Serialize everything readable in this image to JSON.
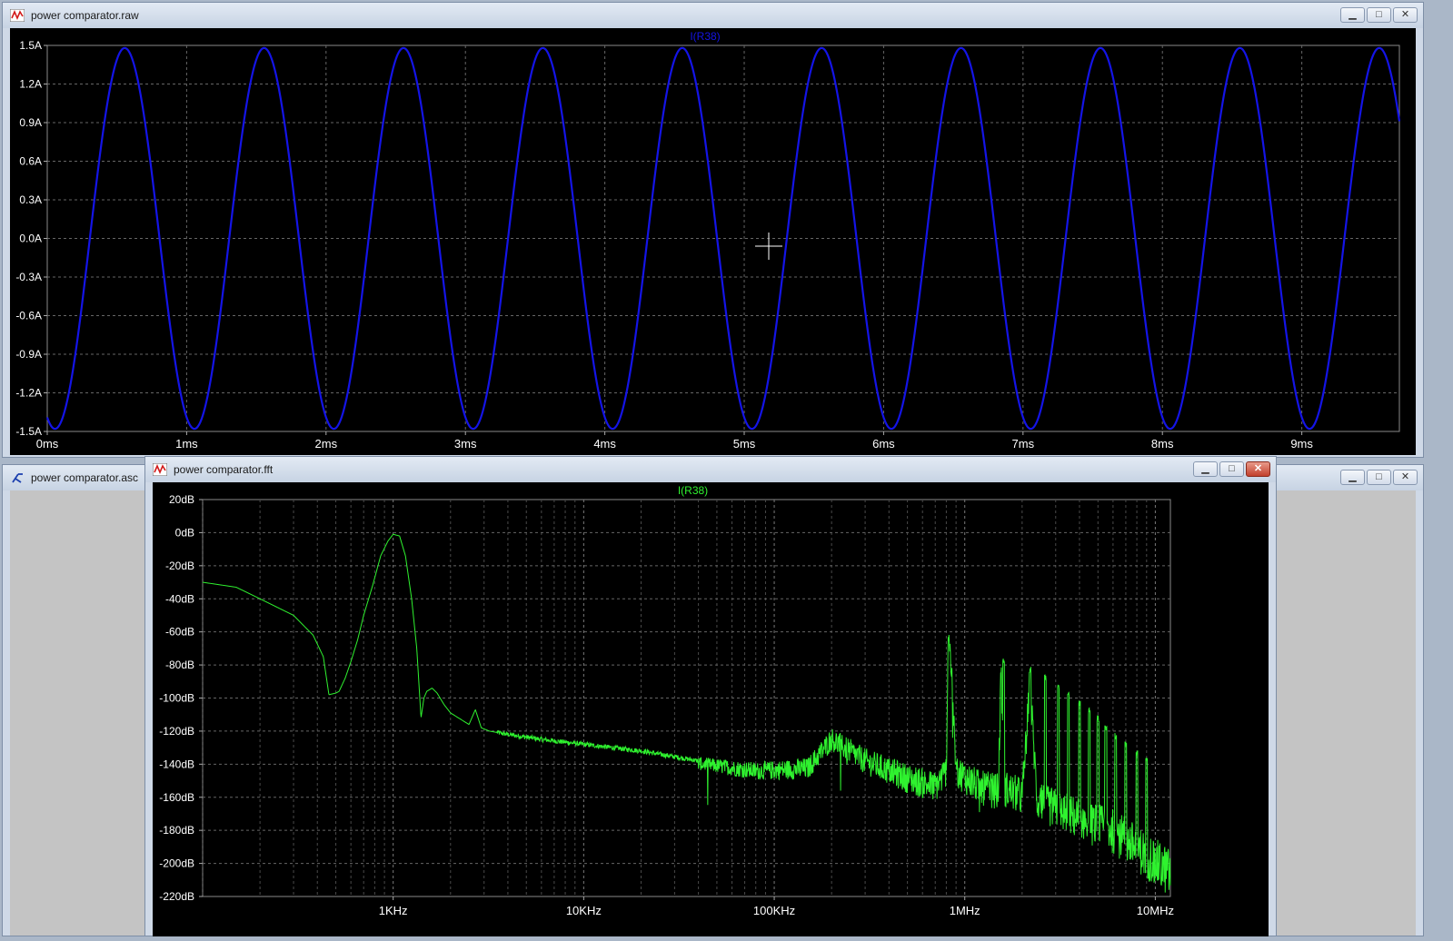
{
  "windows": {
    "raw": {
      "title": "power comparator.raw",
      "buttons": [
        "minimize",
        "maximize",
        "close"
      ]
    },
    "asc": {
      "title": "power comparator.asc"
    },
    "fft": {
      "title": "power comparator.fft"
    }
  },
  "icons": {
    "raw": "waveform-icon",
    "asc": "schematic-icon",
    "fft": "waveform-icon"
  },
  "colors": {
    "trace_raw": "#1414e6",
    "trace_fft": "#2ff22f",
    "plot_bg": "#000000",
    "axis_text": "#ffffff"
  },
  "chart_data": [
    {
      "type": "line",
      "title": "I(R38)",
      "series": [
        {
          "name": "I(R38)",
          "function": "sine",
          "amplitude": 1.48,
          "frequency_hz": 1000,
          "phase_deg": 250
        }
      ],
      "xlabel": "",
      "ylabel": "",
      "xlim": [
        0,
        9.7
      ],
      "xunit": "ms",
      "ylim": [
        -1.5,
        1.5
      ],
      "x_ticks": [
        "0ms",
        "1ms",
        "2ms",
        "3ms",
        "4ms",
        "5ms",
        "6ms",
        "7ms",
        "8ms",
        "9ms"
      ],
      "y_ticks": [
        "1.5A",
        "1.2A",
        "0.9A",
        "0.6A",
        "0.3A",
        "0.0A",
        "-0.3A",
        "-0.6A",
        "-0.9A",
        "-1.2A",
        "-1.5A"
      ],
      "grid": true
    },
    {
      "type": "line",
      "title": "I(R38)",
      "x_scale": "log",
      "xlim": [
        100,
        12000000
      ],
      "ylim": [
        -220,
        20
      ],
      "x_ticks": [
        "1KHz",
        "10KHz",
        "100KHz",
        "1MHz",
        "10MHz"
      ],
      "y_ticks": [
        "20dB",
        "0dB",
        "-20dB",
        "-40dB",
        "-60dB",
        "-80dB",
        "-100dB",
        "-120dB",
        "-140dB",
        "-160dB",
        "-180dB",
        "-200dB",
        "-220dB"
      ],
      "grid": true,
      "series": [
        {
          "name": "I(R38)",
          "x": [
            100,
            150,
            200,
            300,
            380,
            430,
            460,
            500,
            520,
            560,
            600,
            650,
            700,
            780,
            860,
            940,
            1000,
            1080,
            1160,
            1250,
            1330,
            1400,
            1450,
            1500,
            1600,
            1700,
            1850,
            2000,
            2200,
            2500,
            2700,
            2900,
            3200,
            4000,
            6000,
            10000,
            20000,
            40000,
            80000,
            150000,
            200000,
            300000,
            500000,
            700000,
            800000,
            820000,
            850000,
            900000,
            1200000,
            1500000,
            1550000,
            1600000,
            2000000,
            2200000,
            2400000,
            3000000,
            4000000,
            6000000,
            8000000,
            12000000
          ],
          "y": [
            -30,
            -33,
            -40,
            -50,
            -62,
            -75,
            -98,
            -97,
            -96,
            -88,
            -78,
            -65,
            -50,
            -32,
            -14,
            -5,
            -1,
            -2,
            -14,
            -40,
            -70,
            -112,
            -100,
            -96,
            -94,
            -97,
            -104,
            -109,
            -112,
            -116,
            -107,
            -118,
            -120,
            -122,
            -125,
            -128,
            -132,
            -138,
            -142,
            -140,
            -122,
            -135,
            -145,
            -150,
            -140,
            -52,
            -80,
            -140,
            -150,
            -152,
            -78,
            -150,
            -155,
            -88,
            -158,
            -162,
            -168,
            -175,
            -185,
            -200
          ]
        }
      ]
    }
  ]
}
